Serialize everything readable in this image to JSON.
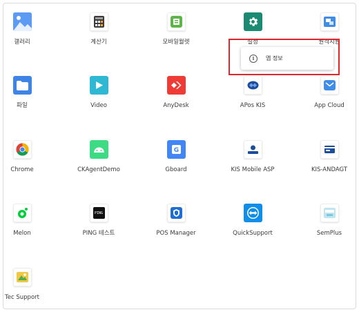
{
  "apps": [
    {
      "id": "gallery",
      "label": "갤러리",
      "icon": "gallery-icon",
      "color": "#4a8cf0"
    },
    {
      "id": "calculator",
      "label": "계산기",
      "icon": "calculator-icon",
      "color": "#3b3b3b"
    },
    {
      "id": "mobile-wallet",
      "label": "모바일월렛",
      "icon": "wallet-icon",
      "color": "#4caf50"
    },
    {
      "id": "settings",
      "label": "설정",
      "icon": "gear-icon",
      "color": "#1b8a73"
    },
    {
      "id": "remote-support",
      "label": "원격지원",
      "icon": "remote-icon",
      "color": "#3f8de8"
    },
    {
      "id": "files",
      "label": "파일",
      "icon": "folder-icon",
      "color": "#3d84e6"
    },
    {
      "id": "video",
      "label": "Video",
      "icon": "play-icon",
      "color": "#2fb8d4"
    },
    {
      "id": "anydesk",
      "label": "AnyDesk",
      "icon": "anydesk-icon",
      "color": "#ef3b36"
    },
    {
      "id": "apos-kis",
      "label": "APos KIS",
      "icon": "apos-icon",
      "color": "#1c4d9a"
    },
    {
      "id": "app-cloud",
      "label": "App Cloud",
      "icon": "cloud-mail-icon",
      "color": "#3f8de8"
    },
    {
      "id": "chrome",
      "label": "Chrome",
      "icon": "chrome-icon",
      "color": "#4285f4"
    },
    {
      "id": "ckagentdemo",
      "label": "CKAgentDemo",
      "icon": "android-icon",
      "color": "#3ddc84"
    },
    {
      "id": "gboard",
      "label": "Gboard",
      "icon": "gboard-icon",
      "color": "#4285f4"
    },
    {
      "id": "kis-mobile-asp",
      "label": "KIS Mobile ASP",
      "icon": "kis-asp-icon",
      "color": "#1c4d9a"
    },
    {
      "id": "kis-andagt",
      "label": "KIS-ANDAGT",
      "icon": "card-icon",
      "color": "#1c4d9a"
    },
    {
      "id": "melon",
      "label": "Melon",
      "icon": "melon-icon",
      "color": "#00cd3c"
    },
    {
      "id": "ping-test",
      "label": "PING 테스트",
      "icon": "terminal-icon",
      "color": "#111111"
    },
    {
      "id": "pos-manager",
      "label": "POS Manager",
      "icon": "shield-icon",
      "color": "#1f6ed4"
    },
    {
      "id": "quicksupport",
      "label": "QuickSupport",
      "icon": "quicksupport-icon",
      "color": "#0e8ee9"
    },
    {
      "id": "semplus",
      "label": "SemPlus",
      "icon": "semplus-icon",
      "color": "#9ad7e8"
    },
    {
      "id": "tec-support",
      "label": "Tec Support",
      "icon": "tec-support-icon",
      "color": "#f2c744"
    }
  ],
  "popup": {
    "item_label": "앱 정보",
    "icon": "info-icon"
  },
  "highlight_color": "#e0262a"
}
